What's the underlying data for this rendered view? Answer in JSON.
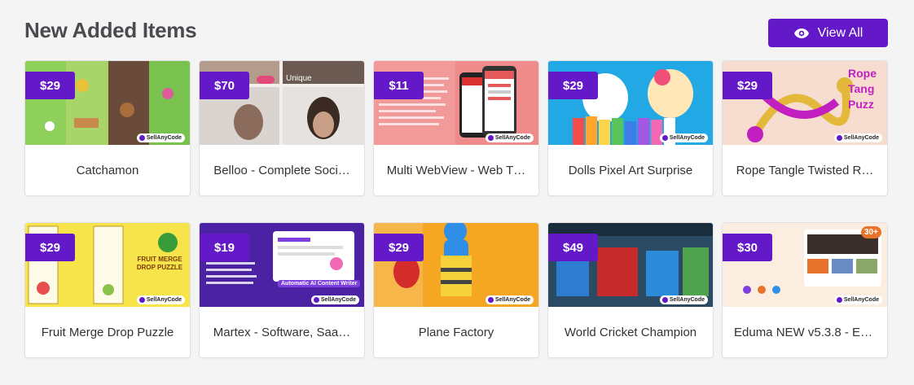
{
  "section": {
    "title": "New Added Items",
    "view_all_label": "View All",
    "accent": "#6419c9"
  },
  "watermark": "SellAnyCode",
  "items": [
    {
      "price": "$29",
      "name": "Catchamon",
      "thumb_colors": [
        "#7ac14b",
        "#a86f3d"
      ]
    },
    {
      "price": "$70",
      "name": "Belloo - Complete Soci…",
      "thumb_colors": [
        "#d9d4cf",
        "#8b6b5b"
      ],
      "overlay_text": "Unique"
    },
    {
      "price": "$11",
      "name": "Multi WebView - Web T…",
      "thumb_colors": [
        "#f08b8b",
        "#e45a5a"
      ]
    },
    {
      "price": "$29",
      "name": "Dolls Pixel Art Surprise",
      "thumb_colors": [
        "#23a8e6",
        "#fcd54a"
      ]
    },
    {
      "price": "$29",
      "name": "Rope Tangle Twisted R…",
      "thumb_colors": [
        "#f6ddcf",
        "#c21fc1"
      ],
      "overlay_text": "Rope Tang Puzz"
    },
    {
      "price": "$29",
      "name": "Fruit Merge Drop Puzzle",
      "thumb_colors": [
        "#f7e34a",
        "#ffffff"
      ],
      "overlay_text": "FRUIT MERGE DROP PUZZLE"
    },
    {
      "price": "$19",
      "name": "Martex - Software, Saa…",
      "thumb_colors": [
        "#3b1d86",
        "#7d3fe0"
      ],
      "overlay_text": "Automatic AI Content Writer"
    },
    {
      "price": "$29",
      "name": "Plane Factory",
      "thumb_colors": [
        "#f5a623",
        "#2f8ee8"
      ]
    },
    {
      "price": "$49",
      "name": "World Cricket Champion",
      "thumb_colors": [
        "#2b4a63",
        "#c62a2a"
      ]
    },
    {
      "price": "$30",
      "name": "Eduma NEW v5.3.8 - Ed…",
      "thumb_colors": [
        "#fbeee0",
        "#e7732c"
      ],
      "overlay_text": "30+"
    }
  ]
}
